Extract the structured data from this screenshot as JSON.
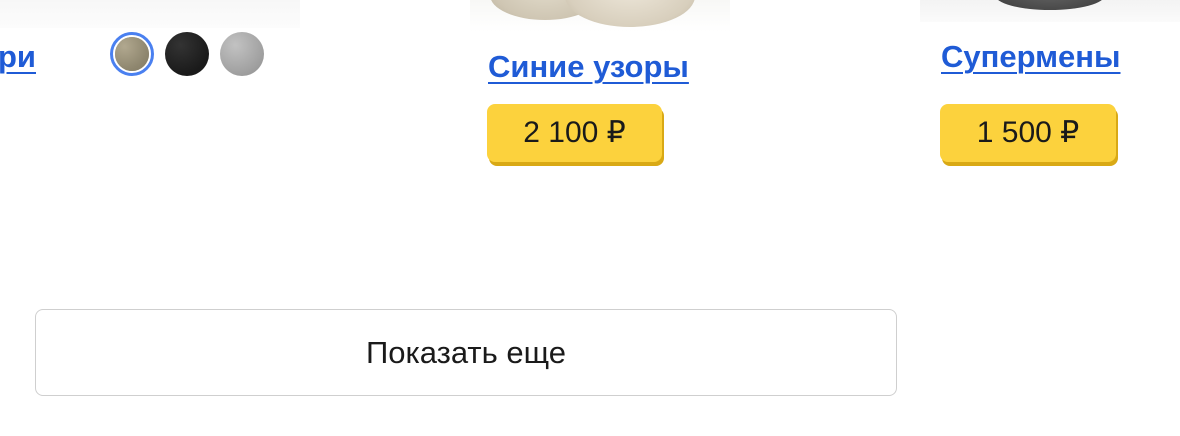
{
  "products": [
    {
      "title": "ри",
      "swatches": [
        {
          "color": "#9c937c",
          "selected": true
        },
        {
          "color": "#1a1a1a",
          "selected": false
        },
        {
          "color": "#a8a8a8",
          "selected": false
        }
      ]
    },
    {
      "title": "Синие узоры",
      "price": "2 100 ₽"
    },
    {
      "title": "Супермены",
      "price": "1 500 ₽"
    }
  ],
  "show_more_label": "Показать еще",
  "colors": {
    "link": "#1f5bd6",
    "price_badge": "#fcd23d",
    "price_shadow": "#d9a915",
    "swatch_selected_ring": "#4a80f0"
  }
}
